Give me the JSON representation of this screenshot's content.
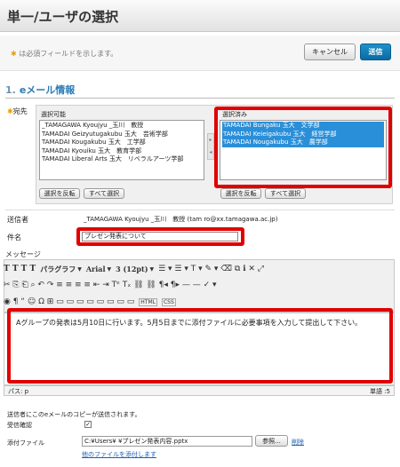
{
  "header": {
    "title": "単一/ユーザの選択"
  },
  "required_note": {
    "star": "✱",
    "text": "は必須フィールドを示します。"
  },
  "actions": {
    "cancel": "キャンセル",
    "submit": "送信"
  },
  "section": {
    "number": "1.",
    "title": "eメール情報"
  },
  "recipients": {
    "label": "宛先",
    "star": "✱",
    "available_label": "選択可能",
    "available": [
      "_TAMAGAWA Kyoujyu _玉川　教授",
      "TAMADAI Geizyutugakubu 玉大　芸術学部",
      "TAMADAI Kougakubu 玉大　工学部",
      "TAMADAI Kyouiku 玉大　教育学部",
      "TAMADAI Liberal Arts 玉大　リベラルアーツ学部"
    ],
    "selected_label": "選択済み",
    "selected": [
      "TAMADAI Bungaku 玉大　文学部",
      "TAMADAI Keieigakubu 玉大　経営学部",
      "TAMADAI Nougakubu 玉大　農学部"
    ],
    "invert_label": "選択を反転",
    "select_all_label": "すべて選択"
  },
  "sender": {
    "label": "送信者",
    "value": "_TAMAGAWA Kyoujyu _玉川　教授 (tam          ro@xx.tamagawa.ac.jp)"
  },
  "subject": {
    "label": "件名",
    "value": "プレゼン発表について"
  },
  "message": {
    "label": "メッセージ",
    "toolbar": {
      "row1_a": "T  T  T  T",
      "format": "パラグラフ",
      "font": "Arial",
      "size": "3 (12pt)",
      "row1_b": "☰ ▾   ☰ ▾   T ▾   ✎ ▾   ⌫   ⧉   ℹ   ✕   ⤢",
      "row2": "✂  ⎘  ⎗  ⌕  ↶  ↷   ≡  ≡  ≡  ≡   ⇤  ⇥   Tᵉ  Tₓ   ⛓  ⛓   ¶◂  ¶▸  —  —  ✓ ▾",
      "row3": "◉  ¶  “  ☺  Ω  ⊞  ▭  ▭  ▭  ▭  ▭  ▭  ▭  ▭",
      "html": "HTML",
      "css": "CSS"
    },
    "body": "Aグループの発表は5月10日に行います。5月5日までに添付ファイルに必要事項を入力して提出して下さい。",
    "path_label": "パス: p",
    "word_count": "単語 :5"
  },
  "copy_note": "送信者にこのeメールのコピーが送信されます。",
  "receipt": {
    "label": "受信確認",
    "check": "✓"
  },
  "attachment": {
    "label": "添付ファイル",
    "value": "C:¥Users¥              ¥プレゼン発表内容.pptx",
    "browse": "参照...",
    "remove": "削除",
    "add_more": "他のファイルを添付します"
  }
}
